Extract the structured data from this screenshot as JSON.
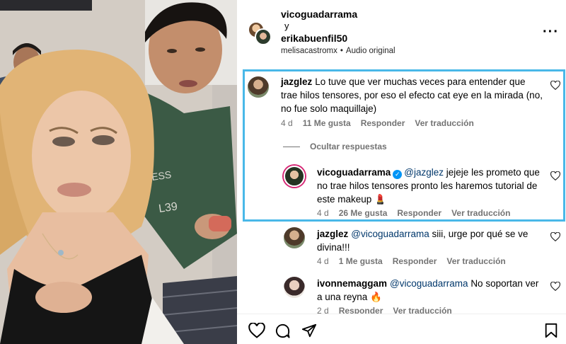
{
  "header": {
    "user1": "vicoguadarrama",
    "conjunction": "y",
    "user2": "erikabuenfil50",
    "audio_user": "melisacastromx",
    "audio_separator": "•",
    "audio_label": "Audio original",
    "more_icon": "···"
  },
  "comments": [
    {
      "user": "jazglez",
      "text": "Lo tuve que ver muchas veces para entender que trae hilos tensores, por eso el efecto cat eye en la mirada (no, no fue solo maquillaje)",
      "time": "4 d",
      "likes": "11 Me gusta",
      "reply": "Responder",
      "translate": "Ver traducción"
    }
  ],
  "hide_replies": "Ocultar respuestas",
  "replies": [
    {
      "user": "vicoguadarrama",
      "mention": "@jazglez",
      "text": "jejeje les prometo que no trae hilos tensores pronto les haremos tutorial de este makeup 💄",
      "time": "4 d",
      "likes": "26 Me gusta",
      "reply": "Responder",
      "translate": "Ver traducción"
    },
    {
      "user": "jazglez",
      "mention": "@vicoguadarrama",
      "text": "siii, urge por qué se ve divina!!!",
      "time": "4 d",
      "likes": "1 Me gusta",
      "reply": "Responder",
      "translate": "Ver traducción"
    },
    {
      "user": "ivonnemaggam",
      "mention": "@vicoguadarrama",
      "text": "No soportan ver a una reyna 🔥",
      "time": "2 d",
      "likes": "",
      "reply": "Responder",
      "translate": "Ver traducción"
    }
  ],
  "colors": {
    "highlight": "#49b8e8",
    "verified": "#0095f6",
    "meta": "#737373",
    "mention": "#00376b"
  },
  "icons": [
    "heart-icon",
    "comment-icon",
    "share-icon",
    "bookmark-icon",
    "more-icon",
    "verified-icon"
  ]
}
